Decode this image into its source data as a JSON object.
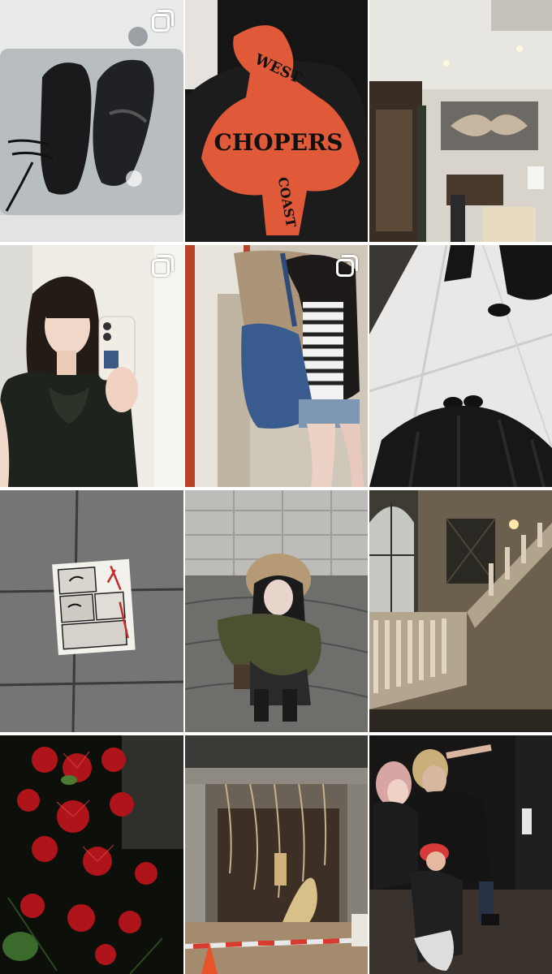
{
  "profile_grid": {
    "columns": 3,
    "posts": [
      {
        "id": "post-1",
        "subject": "black sneakers soaking in sink",
        "multi_photo": true
      },
      {
        "id": "post-2",
        "subject": "black hoodie with orange print",
        "print_text_top": "WEST",
        "print_text_mid": "CHOPERS",
        "print_text_bottom": "COAST",
        "multi_photo": false
      },
      {
        "id": "post-3",
        "subject": "interior hallway with cabinet and flower art",
        "multi_photo": false
      },
      {
        "id": "post-4",
        "subject": "mirror selfie in black ruffle dress",
        "multi_photo": true
      },
      {
        "id": "post-5",
        "subject": "mirror selfie with denim bag",
        "multi_photo": true
      },
      {
        "id": "post-6",
        "subject": "feet on tiled floor in black skirt",
        "multi_photo": false
      },
      {
        "id": "post-7",
        "subject": "manga sticker on pavement",
        "multi_photo": false
      },
      {
        "id": "post-8",
        "subject": "crouching girl in fur hood jacket",
        "multi_photo": false
      },
      {
        "id": "post-9",
        "subject": "old building stone staircase at night",
        "multi_photo": false
      },
      {
        "id": "post-10",
        "subject": "red spider lilies at night",
        "multi_photo": false
      },
      {
        "id": "post-11",
        "subject": "construction site with hanging cables",
        "multi_photo": false
      },
      {
        "id": "post-12",
        "subject": "group photo of friends at night",
        "multi_photo": false
      }
    ]
  },
  "colors": {
    "background": "#ffffff",
    "hoodie_print": "#e05a3a",
    "flowers": "#b0141b",
    "cone": "#e8532b"
  },
  "icons": {
    "multi_photo": "carousel-stack-icon"
  }
}
